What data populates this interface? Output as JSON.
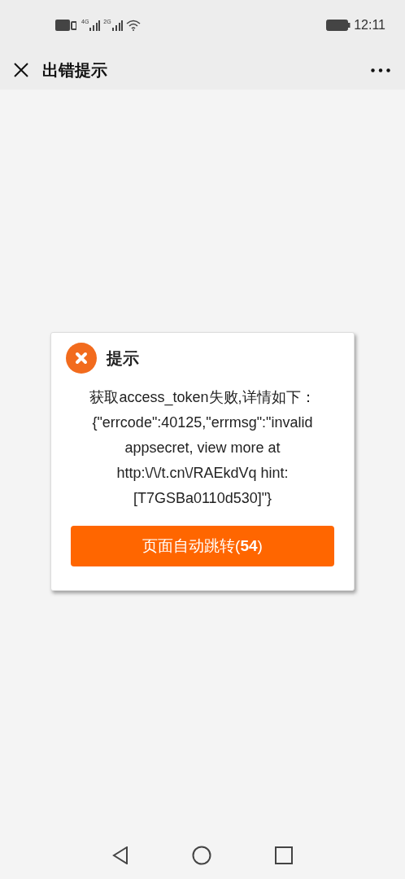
{
  "status_bar": {
    "network_labels": [
      "4G",
      "2G"
    ],
    "time": "12:11"
  },
  "title_bar": {
    "title": "出错提示"
  },
  "dialog": {
    "title": "提示",
    "message": "获取access_token失败,详情如下：{\"errcode\":40125,\"errmsg\":\"invalid appsecret, view more at http:\\/\\/t.cn\\/RAEkdVq hint: [T7GSBa0110d530]\"}",
    "button": "页面自动跳转(**54**)"
  }
}
